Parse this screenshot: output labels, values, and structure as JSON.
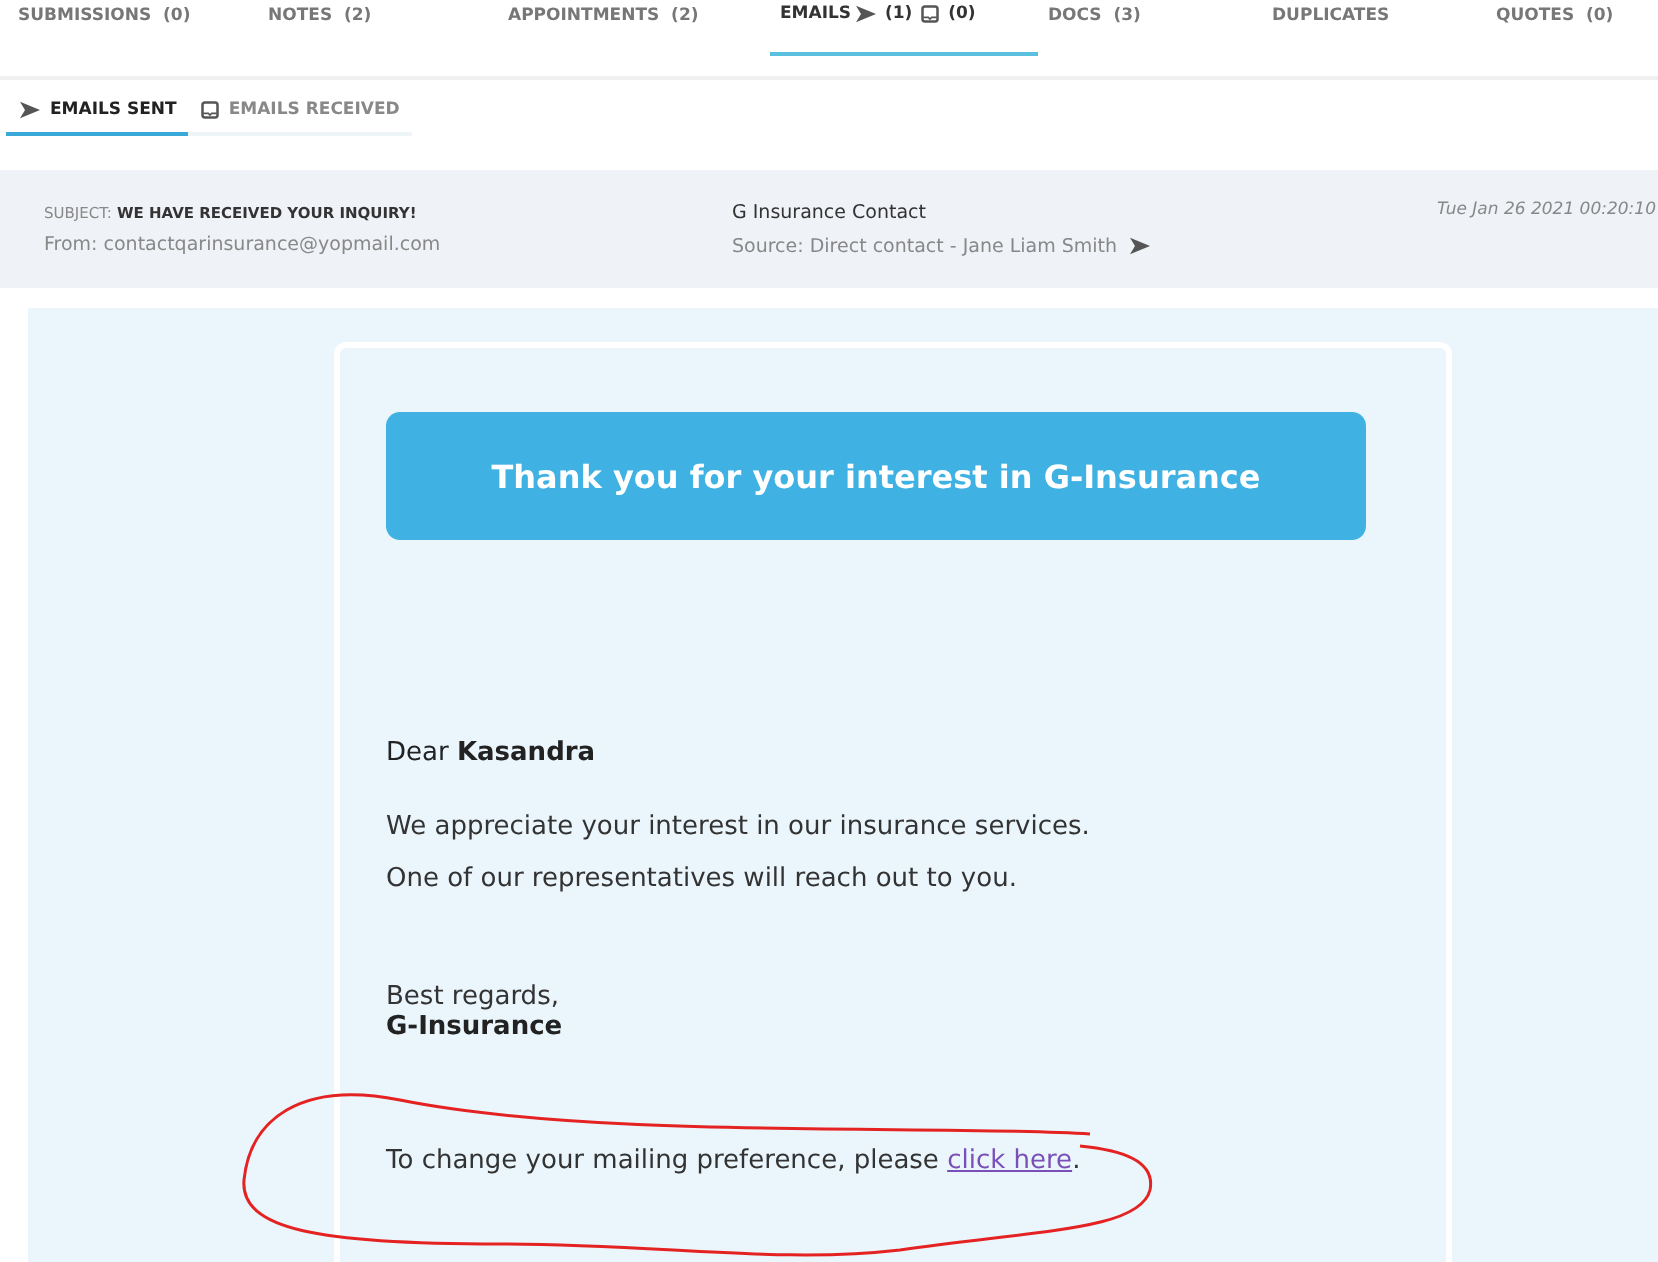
{
  "tabs": [
    {
      "kind": "text",
      "label": "SUBMISSIONS",
      "count": "(0)",
      "selected": false
    },
    {
      "kind": "text",
      "label": "NOTES",
      "count": "(2)",
      "selected": false
    },
    {
      "kind": "text",
      "label": "APPOINTMENTS",
      "count": "(2)",
      "selected": false
    },
    {
      "kind": "email",
      "label": "EMAILS",
      "sent_count": "(1)",
      "received_count": "(0)",
      "selected": true
    },
    {
      "kind": "text",
      "label": "DOCS",
      "count": "(3)",
      "selected": false
    },
    {
      "kind": "text",
      "label": "DUPLICATES",
      "selected": false
    },
    {
      "kind": "text",
      "label": "QUOTES",
      "count": "(0)",
      "selected": false
    }
  ],
  "subtabs": [
    {
      "kind": "sent",
      "label": "EMAILS SENT",
      "selected": true
    },
    {
      "kind": "received",
      "label": "EMAILS RECEIVED",
      "selected": false
    }
  ],
  "email_header": {
    "subject_label": "SUBJECT:",
    "subject": "WE HAVE RECEIVED YOUR INQUIRY!",
    "from": "From: contactqarinsurance@yopmail.com",
    "contact": "G Insurance Contact",
    "source": "Source: Direct contact - Jane Liam Smith",
    "date": "Tue Jan 26 2021 00:20:10"
  },
  "email_body": {
    "banner": "Thank you for your interest in G-Insurance",
    "greeting": "Dear **Kasandra**",
    "paragraphs": [
      "We appreciate your interest in our insurance services.",
      "One of our representatives will reach out to you."
    ],
    "closing": "Best regards,",
    "signature": "G-Insurance",
    "footer_text": "To change your mailing preference, please ",
    "footer_link": "click here",
    "footer_end": "."
  }
}
